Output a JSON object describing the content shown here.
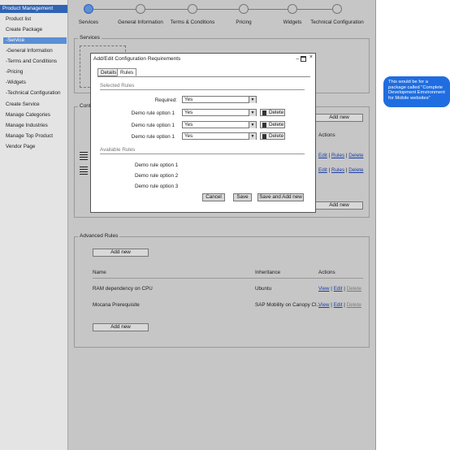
{
  "sidebar": {
    "section_label": "Product Management",
    "items": [
      {
        "label": "Product list"
      },
      {
        "label": "Create Package"
      },
      {
        "label": "-Service"
      },
      {
        "label": "-General Information"
      },
      {
        "label": "-Terms and Conditions"
      },
      {
        "label": "-Pricing"
      },
      {
        "label": "-Widgets"
      },
      {
        "label": "-Technical Configuration"
      },
      {
        "label": "Create Service"
      },
      {
        "label": "Manage Categories"
      },
      {
        "label": "Manage Industries"
      },
      {
        "label": "Manage Top Product"
      },
      {
        "label": "Vendor Page"
      }
    ]
  },
  "wizard": {
    "steps": [
      {
        "label": "Services"
      },
      {
        "label": "General Information"
      },
      {
        "label": "Terms & Conditions"
      },
      {
        "label": "Pricing"
      },
      {
        "label": "Widgets"
      },
      {
        "label": "Technical Configuration"
      }
    ],
    "active_index": 0
  },
  "services_panel": {
    "legend": "Services"
  },
  "config_panel": {
    "legend": "Confi",
    "add_new_top": "Add new",
    "actions_header": "Actions",
    "rows": [
      {
        "edit": "Edit",
        "rules": "Rules",
        "delete": "Delete"
      },
      {
        "edit": "Edit",
        "rules": "Rules",
        "delete": "Delete"
      }
    ],
    "add_new_bottom": "Add new"
  },
  "dialog": {
    "title": "Add/Edit Configuration Requirements",
    "tabs": [
      {
        "label": "Details"
      },
      {
        "label": "Rules"
      }
    ],
    "active_tab": 1,
    "selected_rules_heading": "Selected Rules",
    "required_label": "Required:",
    "required_value": "Yes",
    "rules": [
      {
        "label": "Demo rule option 1",
        "value": "Yes",
        "delete": "Delete"
      },
      {
        "label": "Demo rule option 1",
        "value": "Yes",
        "delete": "Delete"
      },
      {
        "label": "Demo rule option 1",
        "value": "Yes",
        "delete": "Delete"
      }
    ],
    "available_rules_heading": "Available Rules",
    "available_rules": [
      {
        "label": "Demo rule option 1"
      },
      {
        "label": "Demo rule option 2"
      },
      {
        "label": "Demo rule option 3"
      }
    ],
    "cancel_label": "Cancel",
    "save_label": "Save",
    "save_add_label": "Save and Add new"
  },
  "advanced_panel": {
    "legend": "Advanced Rules",
    "add_new_top": "Add new",
    "headers": {
      "name": "Name",
      "inheritance": "Inheritance",
      "actions": "Actions"
    },
    "rows": [
      {
        "name": "RAM dependency on CPU",
        "inheritance": "Ubuntu",
        "view": "View",
        "edit": "Edit",
        "delete": "Delete"
      },
      {
        "name": "Mocana Prerequisite",
        "inheritance": "SAP Mobility on Canopy Cl...",
        "view": "View",
        "edit": "Edit",
        "delete": "Delete"
      }
    ],
    "add_new_bottom": "Add new"
  },
  "note": {
    "text": "This would be for a package called \"Complete Development Emvironment for Mobile websites\""
  },
  "colors": {
    "accent": "#2f63b3",
    "selected": "#5b8fd6",
    "note": "#1f6de0",
    "canvas": "#c6c6c6"
  }
}
